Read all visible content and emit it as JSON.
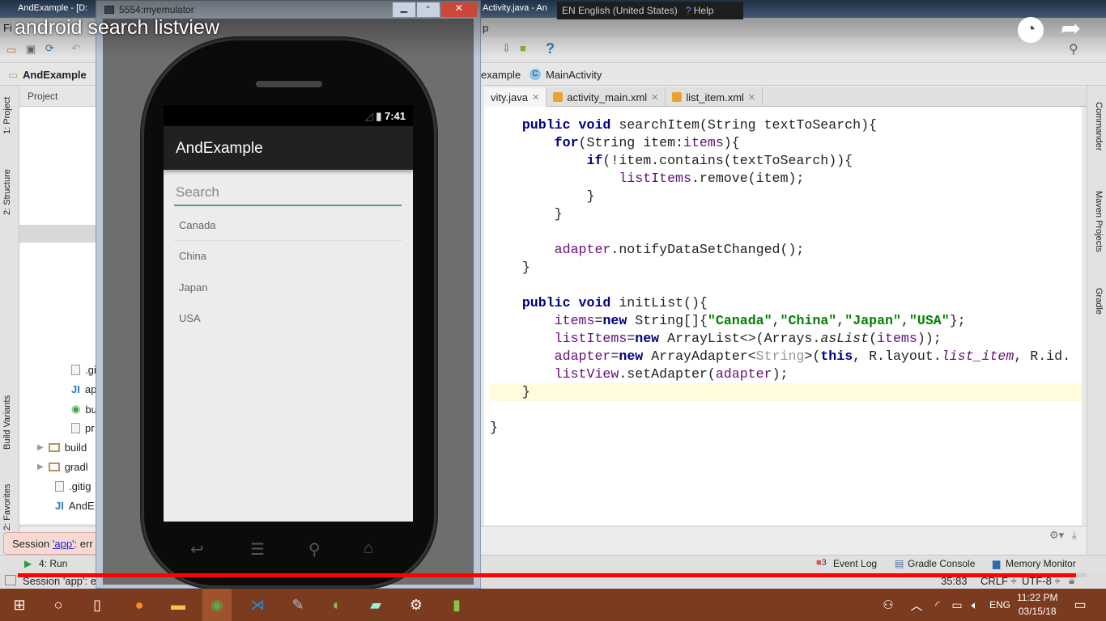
{
  "ide": {
    "window_title_left": "AndExample - [D:",
    "window_title_right": "Activity.java - An",
    "menu_fragment_left": "Fi",
    "menu_fragment_right": "p",
    "language_bar": {
      "lang": "EN English (United States)",
      "help": "Help"
    },
    "breadcrumb": {
      "project": "AndExample",
      "package": "example",
      "class": "MainActivity"
    },
    "tabs": [
      {
        "label": "vity.java",
        "active": true
      },
      {
        "label": "activity_main.xml",
        "active": false
      },
      {
        "label": "list_item.xml",
        "active": false
      }
    ],
    "left_stripe": [
      "1: Project",
      "2: Structure",
      "Build Variants",
      "2: Favorites"
    ],
    "right_stripe": [
      "Commander",
      "Maven Projects",
      "Gradle"
    ],
    "project_panel": {
      "header": "Project",
      "items": [
        ".gi",
        "ap",
        "bu",
        "pr",
        "build",
        "gradl",
        ".gitig",
        "AndE"
      ]
    },
    "code_lines": [
      [
        {
          "t": "    "
        },
        {
          "t": "public void ",
          "c": "kw"
        },
        {
          "t": "searchItem(String textToSearch){"
        }
      ],
      [
        {
          "t": "        "
        },
        {
          "t": "for",
          "c": "kw"
        },
        {
          "t": "(String item:"
        },
        {
          "t": "items",
          "c": "fld"
        },
        {
          "t": "){"
        }
      ],
      [
        {
          "t": "            "
        },
        {
          "t": "if",
          "c": "kw"
        },
        {
          "t": "(!item.contains(textToSearch)){"
        }
      ],
      [
        {
          "t": "                "
        },
        {
          "t": "listItems",
          "c": "fld"
        },
        {
          "t": ".remove(item);"
        }
      ],
      [
        {
          "t": "            }"
        }
      ],
      [
        {
          "t": "        }"
        }
      ],
      [],
      [
        {
          "t": "        "
        },
        {
          "t": "adapter",
          "c": "fld"
        },
        {
          "t": ".notifyDataSetChanged();"
        }
      ],
      [
        {
          "t": "    }"
        }
      ],
      [],
      [
        {
          "t": "    "
        },
        {
          "t": "public void ",
          "c": "kw"
        },
        {
          "t": "initList(){"
        }
      ],
      [
        {
          "t": "        "
        },
        {
          "t": "items",
          "c": "fld"
        },
        {
          "t": "="
        },
        {
          "t": "new ",
          "c": "kw"
        },
        {
          "t": "String[]{"
        },
        {
          "t": "\"Canada\"",
          "c": "str"
        },
        {
          "t": ","
        },
        {
          "t": "\"China\"",
          "c": "str"
        },
        {
          "t": ","
        },
        {
          "t": "\"Japan\"",
          "c": "str"
        },
        {
          "t": ","
        },
        {
          "t": "\"USA\"",
          "c": "str"
        },
        {
          "t": "};"
        }
      ],
      [
        {
          "t": "        "
        },
        {
          "t": "listItems",
          "c": "fld"
        },
        {
          "t": "="
        },
        {
          "t": "new ",
          "c": "kw"
        },
        {
          "t": "ArrayList<>(Arrays."
        },
        {
          "t": "asList",
          "c": "it"
        },
        {
          "t": "("
        },
        {
          "t": "items",
          "c": "fld"
        },
        {
          "t": "));"
        }
      ],
      [
        {
          "t": "        "
        },
        {
          "t": "adapter",
          "c": "fld"
        },
        {
          "t": "="
        },
        {
          "t": "new ",
          "c": "kw"
        },
        {
          "t": "ArrayAdapter<"
        },
        {
          "t": "String",
          "c": "gry"
        },
        {
          "t": ">("
        },
        {
          "t": "this",
          "c": "kw"
        },
        {
          "t": ", R.layout."
        },
        {
          "t": "list_item",
          "c": "it fld"
        },
        {
          "t": ", R.id."
        }
      ],
      [
        {
          "t": "        "
        },
        {
          "t": "listView",
          "c": "fld"
        },
        {
          "t": ".setAdapter("
        },
        {
          "t": "adapter",
          "c": "fld"
        },
        {
          "t": ");"
        }
      ],
      [
        {
          "t": "    }"
        }
      ],
      [],
      [
        {
          "t": "}"
        }
      ]
    ],
    "highlighted_line": 15,
    "bottom": {
      "session_popup": "Session ",
      "session_link": "'app'",
      "session_suffix": ": err",
      "run_tab": "4: Run",
      "event_log_count": "3",
      "event_log": "Event Log",
      "gradle_console": "Gradle Console",
      "memory_monitor": "Memory Monitor",
      "status_text": "Session 'app': e",
      "cursor_pos": "35:83",
      "line_sep": "CRLF ÷",
      "encoding": "UTF-8 ÷"
    }
  },
  "emulator": {
    "window_title": "5554:myemulator",
    "clock": "7:41",
    "app_title": "AndExample",
    "search_placeholder": "Search",
    "search_value": "",
    "list_items": [
      "Canada",
      "China",
      "Japan",
      "USA"
    ]
  },
  "video": {
    "title": "android search listview",
    "progress": 0.99,
    "progress_color": "#ff0000"
  },
  "taskbar": {
    "time": "11:22 PM",
    "date": "03/15/18",
    "lang": "ENG",
    "color": "#7b3b1e"
  }
}
